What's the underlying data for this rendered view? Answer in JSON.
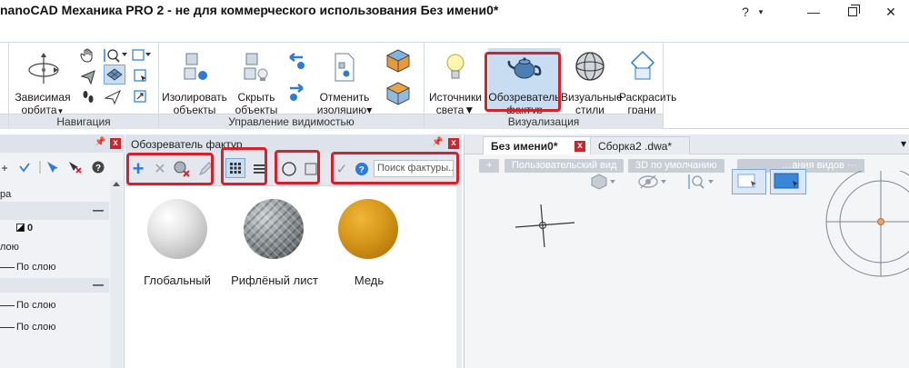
{
  "window": {
    "title": "nanoCAD Механика PRO 2 - не для коммерческого использования Без имени0*",
    "help": "?",
    "help_arrow": "▾",
    "minimize": "—",
    "close": "✕"
  },
  "ribbon": {
    "navigation": {
      "label": "Навигация",
      "orbit_line1": "Зависимая",
      "orbit_line2": "орбита",
      "orbit_arrow": "▼"
    },
    "visibility": {
      "label": "Управление видимостью",
      "isolate_line1": "Изолировать",
      "isolate_line2": "объекты",
      "hide_line1": "Скрыть",
      "hide_line2": "объекты",
      "cancel_line1": "Отменить",
      "cancel_line2": "изоляцию▾"
    },
    "visualization": {
      "label": "Визуализация",
      "lights_line1": "Источники",
      "lights_line2": "света▼",
      "texbrowser_line1": "Обозреватель",
      "texbrowser_line2": "фактур",
      "visstyles_line1": "Визуальные",
      "visstyles_line2": "стили",
      "paintfaces_line1": "Раскрасить",
      "paintfaces_line2": "грани"
    }
  },
  "left_panel": {
    "row1": "ра",
    "row2_value": "0",
    "row3": "лою",
    "row4": "По слою",
    "row5": "По слою",
    "row6": "По слою",
    "minus": "—"
  },
  "texture_panel": {
    "title": "Обозреватель фактур",
    "pin": "📌",
    "close": "x",
    "tools": {
      "add": "+",
      "delete": "✕",
      "view_tiles": "▦",
      "view_list": "☰",
      "shape_sphere": "○",
      "shape_cube": "□",
      "apply": "✓",
      "help": "?"
    },
    "search_placeholder": "Поиск фактуры...",
    "materials": [
      {
        "name": "Глобальный"
      },
      {
        "name": "Рифлёный лист"
      },
      {
        "name": "Медь"
      }
    ]
  },
  "drawing": {
    "tabs": [
      {
        "label": "Без имени0*",
        "close": "x"
      },
      {
        "label": "Сборка2 .dwa*"
      }
    ],
    "tabs_menu": "▾",
    "viewbar": {
      "plus": "+",
      "custom_view": "Пользовательский вид",
      "default_3d": "3D по умолчанию",
      "views_config": "…ания видов ···"
    }
  },
  "colors": {
    "highlight": "#d9202a",
    "accent_blue": "#2b7bd8",
    "copper": "#c98510"
  }
}
